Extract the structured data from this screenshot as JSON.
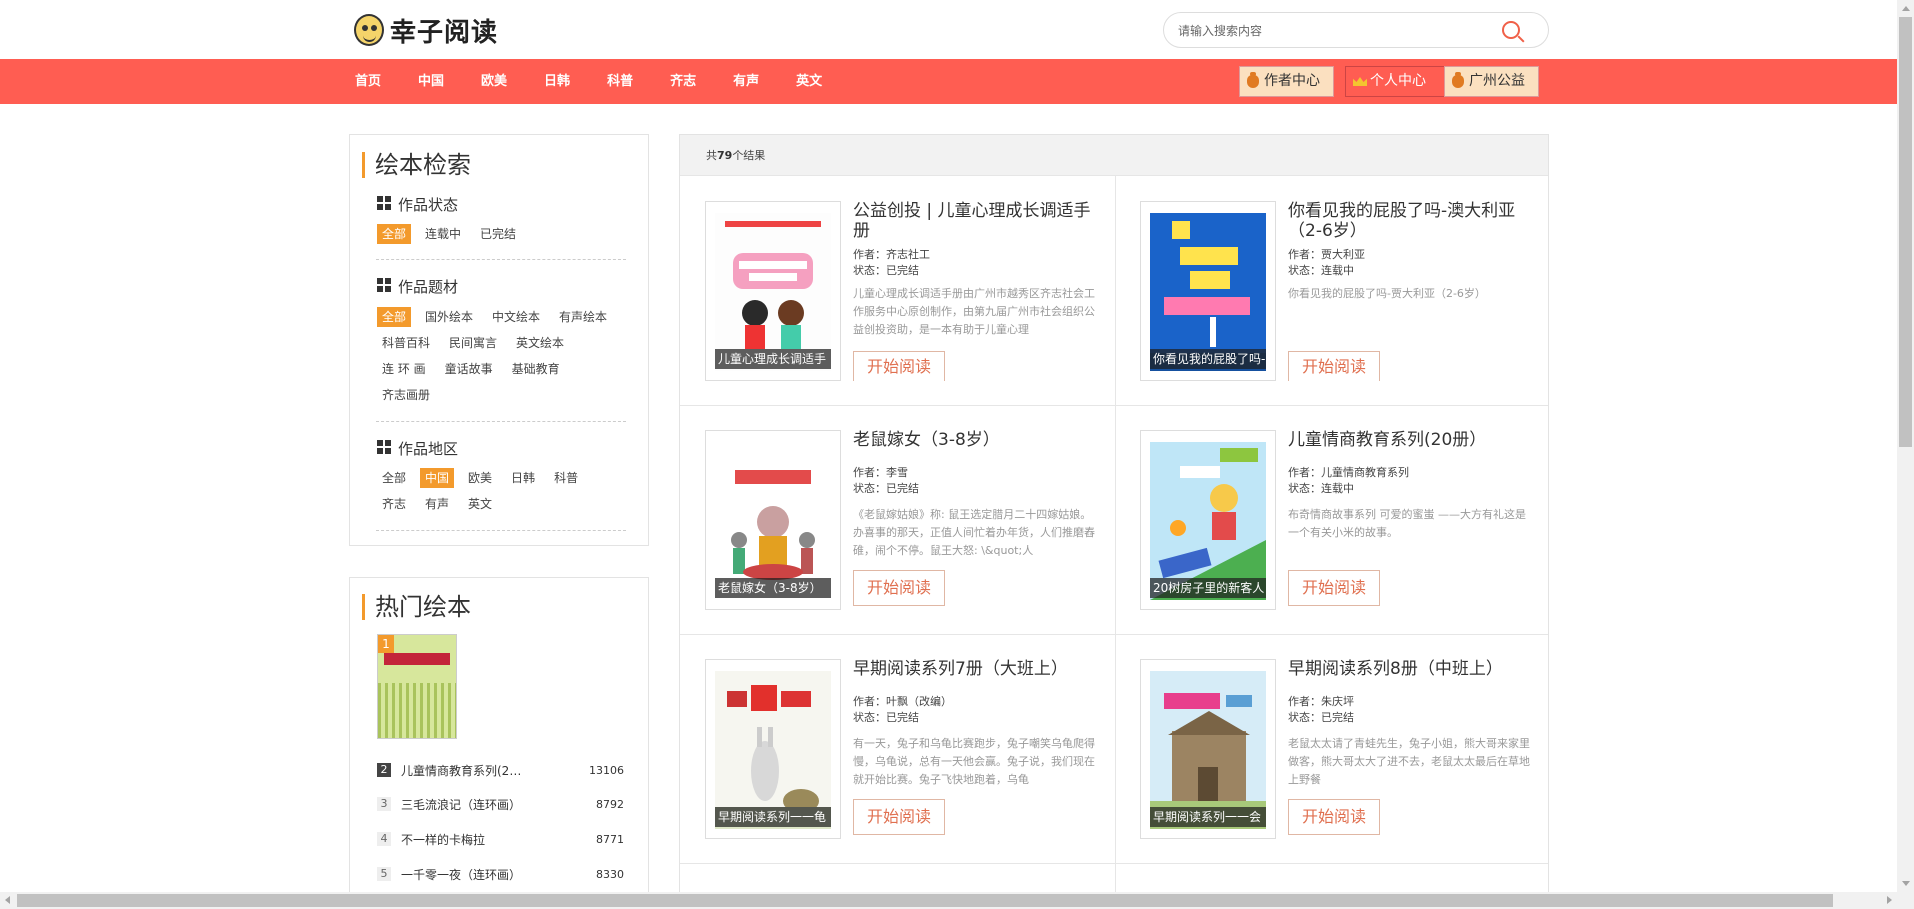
{
  "header": {
    "logo_text": "幸子阅读",
    "search_placeholder": "请输入搜索内容"
  },
  "nav": {
    "items": [
      "首页",
      "中国",
      "欧美",
      "日韩",
      "科普",
      "齐志",
      "有声",
      "英文"
    ],
    "author_center": "作者中心",
    "personal_center": "个人中心",
    "guangzhou_public": "广州公益"
  },
  "filter": {
    "title": "绘本检索",
    "groups": [
      {
        "title": "作品状态",
        "options": [
          "全部",
          "连载中",
          "已完结"
        ],
        "active": 0
      },
      {
        "title": "作品题材",
        "options": [
          "全部",
          "国外绘本",
          "中文绘本",
          "有声绘本",
          "科普百科",
          "民间寓言",
          "英文绘本",
          "连 环 画",
          "童话故事",
          "基础教育",
          "齐志画册"
        ],
        "active": 0
      },
      {
        "title": "作品地区",
        "options": [
          "全部",
          "中国",
          "欧美",
          "日韩",
          "科普",
          "齐志",
          "有声",
          "英文"
        ],
        "active": 1
      }
    ]
  },
  "hot": {
    "title": "热门绘本",
    "first_rank": "1",
    "items": [
      {
        "rank": "2",
        "name": "儿童情商教育系列(2…",
        "count": "13106"
      },
      {
        "rank": "3",
        "name": "三毛流浪记（连环画）",
        "count": "8792"
      },
      {
        "rank": "4",
        "name": "不一样的卡梅拉",
        "count": "8771"
      },
      {
        "rank": "5",
        "name": "一千零一夜（连环画）",
        "count": "8330"
      }
    ]
  },
  "results": {
    "prefix": "共",
    "count": "79",
    "suffix": "个结果",
    "read_label": "开始阅读",
    "books": [
      {
        "title": "公益创投 | 儿童心理成长调适手册",
        "author": "作者：齐志社工",
        "status": "状态：已完结",
        "desc": "儿童心理成长调适手册由广州市越秀区齐志社会工作服务中心原创制作，由第九届广州市社会组织公益创投资助，是一本有助于儿童心理",
        "caption": "儿童心理成长调适手"
      },
      {
        "title": "你看见我的屁股了吗-澳大利亚（2-6岁）",
        "author": "作者：贾大利亚",
        "status": "状态：连载中",
        "desc": "你看见我的屁股了吗-贾大利亚（2-6岁）",
        "caption": "你看见我的屁股了吗-"
      },
      {
        "title": "老鼠嫁女（3-8岁）",
        "author": "作者：李雪",
        "status": "状态：已完结",
        "desc": "《老鼠嫁姑娘》称: 鼠王选定腊月二十四嫁姑娘。办喜事的那天，正值人间忙着办年货，人们推磨舂碓，闹个不停。鼠王大怒: \\&quot;人",
        "caption": "老鼠嫁女（3-8岁）"
      },
      {
        "title": "儿童情商教育系列(20册）",
        "author": "作者：儿童情商教育系列",
        "status": "状态：连载中",
        "desc": "布奇情商故事系列 可爱的蜜蚩 ——大方有礼这是一个有关小米的故事。",
        "caption": "20树房子里的新客人"
      },
      {
        "title": "早期阅读系列7册（大班上）",
        "author": "作者：叶飘（改编）",
        "status": "状态：已完结",
        "desc": "有一天，兔子和乌龟比赛跑步，兔子嘲笑乌龟爬得慢，乌龟说，总有一天他会赢。兔子说，我们现在就开始比赛。兔子飞快地跑着，乌龟",
        "caption": "早期阅读系列一一龟"
      },
      {
        "title": "早期阅读系列8册（中班上）",
        "author": "作者：朱庆坪",
        "status": "状态：已完结",
        "desc": "老鼠太太请了青蛙先生，兔子小姐，熊大哥来家里做客，熊大哥太大了进不去，老鼠太太最后在草地上野餐",
        "caption": "早期阅读系列一一会"
      }
    ]
  },
  "colors": {
    "nav_bg": "#ff5d52",
    "accent_orange": "#f39a2c",
    "read_text": "#e07050"
  }
}
